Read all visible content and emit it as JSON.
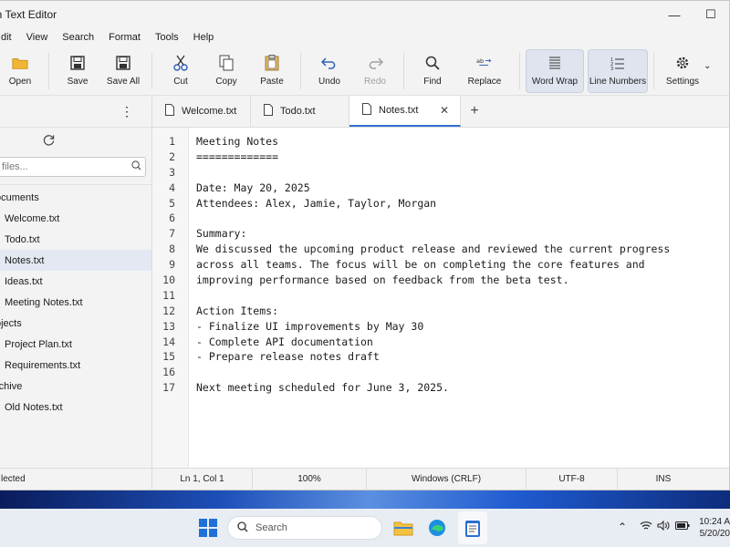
{
  "window": {
    "title": "on Text Editor"
  },
  "menu": [
    "dit",
    "View",
    "Search",
    "Format",
    "Tools",
    "Help"
  ],
  "toolbar": {
    "open": "Open",
    "save": "Save",
    "save_all": "Save All",
    "cut": "Cut",
    "copy": "Copy",
    "paste": "Paste",
    "undo": "Undo",
    "redo": "Redo",
    "find": "Find",
    "replace": "Replace",
    "word_wrap": "Word Wrap",
    "line_numbers": "Line Numbers",
    "settings": "Settings"
  },
  "sidebar": {
    "search_placeholder": "files...",
    "folders": [
      {
        "label": "ocuments",
        "files": [
          "Welcome.txt",
          "Todo.txt",
          "Notes.txt",
          "Ideas.txt",
          "Meeting Notes.txt"
        ]
      },
      {
        "label": "ojects",
        "files": [
          "Project Plan.txt",
          "Requirements.txt"
        ]
      },
      {
        "label": "rchive",
        "files": [
          "Old Notes.txt"
        ]
      }
    ],
    "selected_file": "Notes.txt"
  },
  "tabs": [
    {
      "label": "Welcome.txt",
      "active": false
    },
    {
      "label": "Todo.txt",
      "active": false
    },
    {
      "label": "Notes.txt",
      "active": true
    }
  ],
  "editor": {
    "lines": [
      "Meeting Notes",
      "=============",
      "",
      "Date: May 20, 2025",
      "Attendees: Alex, Jamie, Taylor, Morgan",
      "",
      "Summary:",
      "We discussed the upcoming product release and reviewed the current progress",
      "across all teams. The focus will be on completing the core features and",
      "improving performance based on feedback from the beta test.",
      "",
      "Action Items:",
      "- Finalize UI improvements by May 30",
      "- Complete API documentation",
      "- Prepare release notes draft",
      "",
      "Next meeting scheduled for June 3, 2025."
    ],
    "line_numbers": [
      "1",
      "2",
      "3",
      "4",
      "5",
      "6",
      "7",
      "8",
      "9",
      "10",
      "11",
      "12",
      "13",
      "14",
      "15",
      "16",
      "17"
    ]
  },
  "status": {
    "selection": "lected",
    "position": "Ln 1, Col 1",
    "zoom": "100%",
    "line_ending": "Windows (CRLF)",
    "encoding": "UTF-8",
    "mode": "INS"
  },
  "taskbar": {
    "search_label": "Search",
    "time": "10:24 A",
    "date": "5/20/20"
  },
  "colors": {
    "accent": "#2f6fd6",
    "selected_row": "#e3e8f2",
    "toggle_active": "#dfe4ee"
  }
}
